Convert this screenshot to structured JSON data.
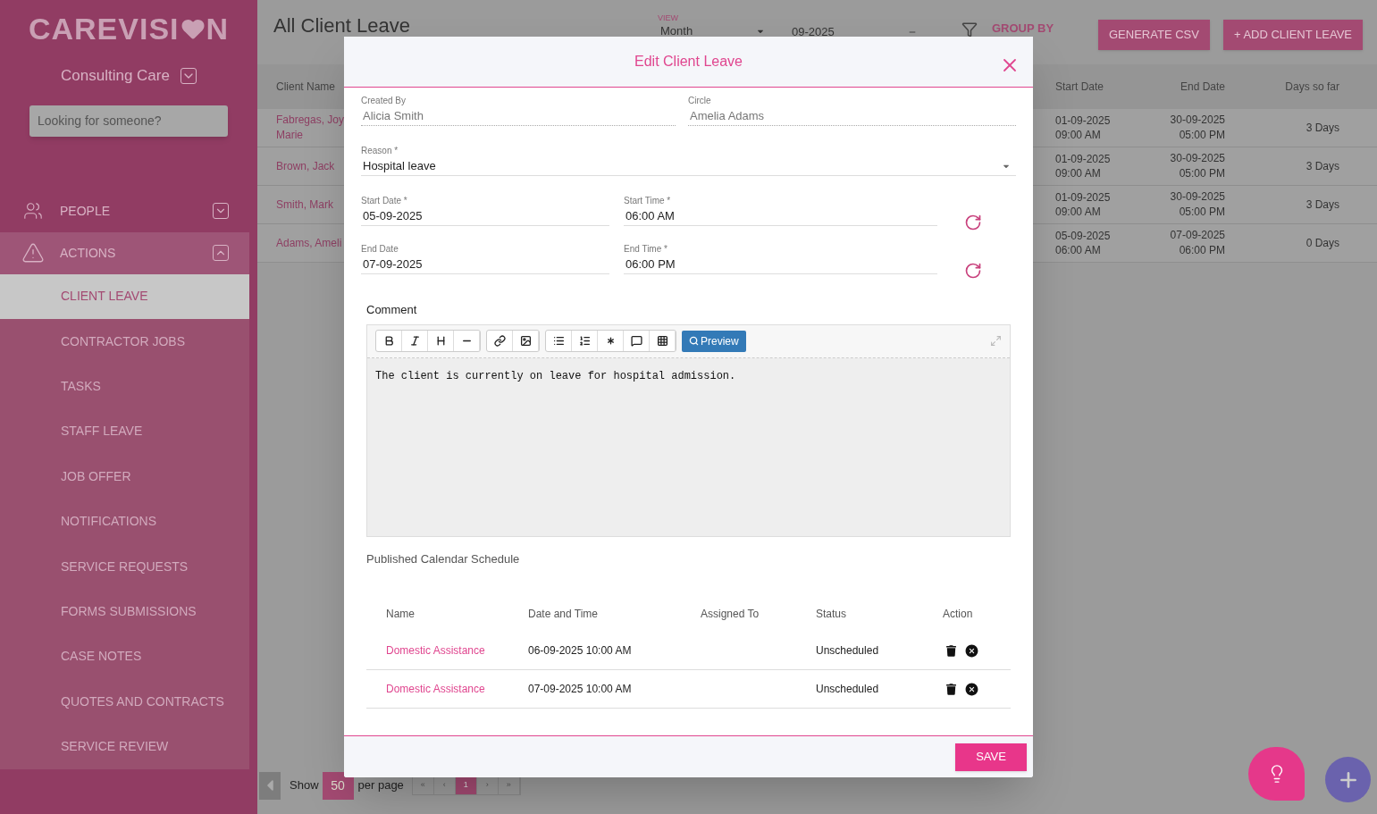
{
  "sidebar": {
    "logo_parts": [
      "CAREVISI",
      "N"
    ],
    "org": "Consulting Care",
    "search": {
      "placeholder": "Looking for someone?"
    },
    "nav": [
      {
        "label": "PEOPLE",
        "kind": "people",
        "expanded": false
      },
      {
        "label": "ACTIONS",
        "kind": "alert",
        "expanded": true,
        "children": [
          {
            "label": "CLIENT LEAVE",
            "selected": true
          },
          {
            "label": "CONTRACTOR JOBS",
            "selected": false
          },
          {
            "label": "TASKS",
            "selected": false
          },
          {
            "label": "STAFF LEAVE",
            "selected": false
          },
          {
            "label": "JOB OFFER",
            "selected": false
          },
          {
            "label": "NOTIFICATIONS",
            "selected": false
          },
          {
            "label": "SERVICE REQUESTS",
            "selected": false
          },
          {
            "label": "FORMS SUBMISSIONS",
            "selected": false
          },
          {
            "label": "CASE NOTES",
            "selected": false
          },
          {
            "label": "QUOTES AND CONTRACTS",
            "selected": false
          },
          {
            "label": "SERVICE REVIEW",
            "selected": false
          }
        ]
      }
    ]
  },
  "page": {
    "title": "All Client Leave",
    "view": {
      "label": "VIEW",
      "value": "Month"
    },
    "period": "09-2025",
    "group_by": "GROUP BY",
    "buttons": [
      "GENERATE CSV",
      "+ ADD CLIENT LEAVE"
    ]
  },
  "table": {
    "columns": [
      "Client Name",
      "Start Date",
      "End Date",
      "Days so far"
    ],
    "rows": [
      {
        "client": "Fabregas, Joy Marie",
        "start": [
          "01-09-2025",
          "09:00 AM"
        ],
        "end": [
          "30-09-2025",
          "05:00 PM"
        ],
        "days": "3 Days"
      },
      {
        "client": "Brown, Jack",
        "start": [
          "01-09-2025",
          "09:00 AM"
        ],
        "end": [
          "30-09-2025",
          "05:00 PM"
        ],
        "days": "3 Days"
      },
      {
        "client": "Smith, Mark",
        "start": [
          "01-09-2025",
          "09:00 AM"
        ],
        "end": [
          "30-09-2025",
          "05:00 PM"
        ],
        "days": "3 Days"
      },
      {
        "client": "Adams, Ameli",
        "start": [
          "05-09-2025",
          "06:00 AM"
        ],
        "end": [
          "07-09-2025",
          "06:00 PM"
        ],
        "days": "0 Days"
      }
    ]
  },
  "pagination": {
    "show": "Show",
    "page_size": "50",
    "per_page": "per page",
    "pages": [
      {
        "label": "«",
        "selected": false
      },
      {
        "label": "‹",
        "selected": false
      },
      {
        "label": "1",
        "selected": true
      },
      {
        "label": "›",
        "selected": false
      },
      {
        "label": "»",
        "selected": false
      }
    ]
  },
  "modal": {
    "title": "Edit Client Leave",
    "created_by": {
      "label": "Created By",
      "value": "Alicia Smith"
    },
    "circle": {
      "label": "Circle",
      "value": "Amelia Adams"
    },
    "reason": {
      "label": "Reason *",
      "value": "Hospital leave"
    },
    "start_date": {
      "label": "Start Date *",
      "value": "05-09-2025"
    },
    "start_time": {
      "label": "Start Time *",
      "value": "06:00 AM"
    },
    "end_date": {
      "label": "End Date",
      "value": "07-09-2025"
    },
    "end_time": {
      "label": "End Time *",
      "value": "06:00 PM"
    },
    "comment": {
      "label": "Comment",
      "preview": "Preview",
      "value": "The client is currently on leave for hospital admission."
    },
    "schedule": {
      "title": "Published Calendar Schedule",
      "columns": [
        "Name",
        "Date and Time",
        "Assigned To",
        "Status",
        "Action"
      ],
      "rows": [
        {
          "name": "Domestic Assistance",
          "datetime": "06-09-2025 10:00 AM",
          "status": "Unscheduled"
        },
        {
          "name": "Domestic Assistance",
          "datetime": "07-09-2025 10:00 AM",
          "status": "Unscheduled"
        }
      ]
    },
    "save": "SAVE"
  }
}
